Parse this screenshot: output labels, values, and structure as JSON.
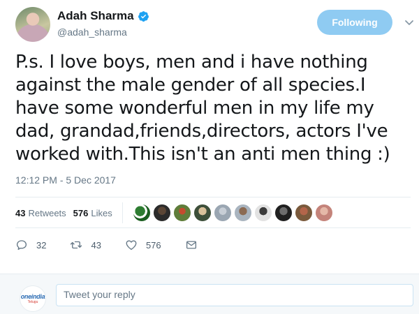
{
  "user": {
    "name": "Adah Sharma",
    "handle": "@adah_sharma",
    "follow_label": "Following"
  },
  "tweet": {
    "text": "P.s. I love boys, men and i have nothing against the male gender of all species.I have some wonderful men in my life my dad, grandad,friends,directors, actors I've worked with.This isn't an anti men thing :)",
    "timestamp": "12:12 PM - 5 Dec 2017"
  },
  "stats": {
    "retweets_count": "43",
    "retweets_label": "Retweets",
    "likes_count": "576",
    "likes_label": "Likes"
  },
  "likers": [
    "liker-1",
    "liker-2",
    "liker-3",
    "liker-4",
    "liker-5",
    "liker-6",
    "liker-7",
    "liker-8",
    "liker-9",
    "liker-10"
  ],
  "actions": {
    "replies": "32",
    "retweets": "43",
    "likes": "576"
  },
  "reply": {
    "placeholder": "Tweet your reply",
    "avatar_brand": "oneindia",
    "avatar_sub": "Telugu"
  },
  "colors": {
    "follow_button": "#8fcbf2",
    "verified": "#1da1f2",
    "secondary_text": "#657786"
  }
}
